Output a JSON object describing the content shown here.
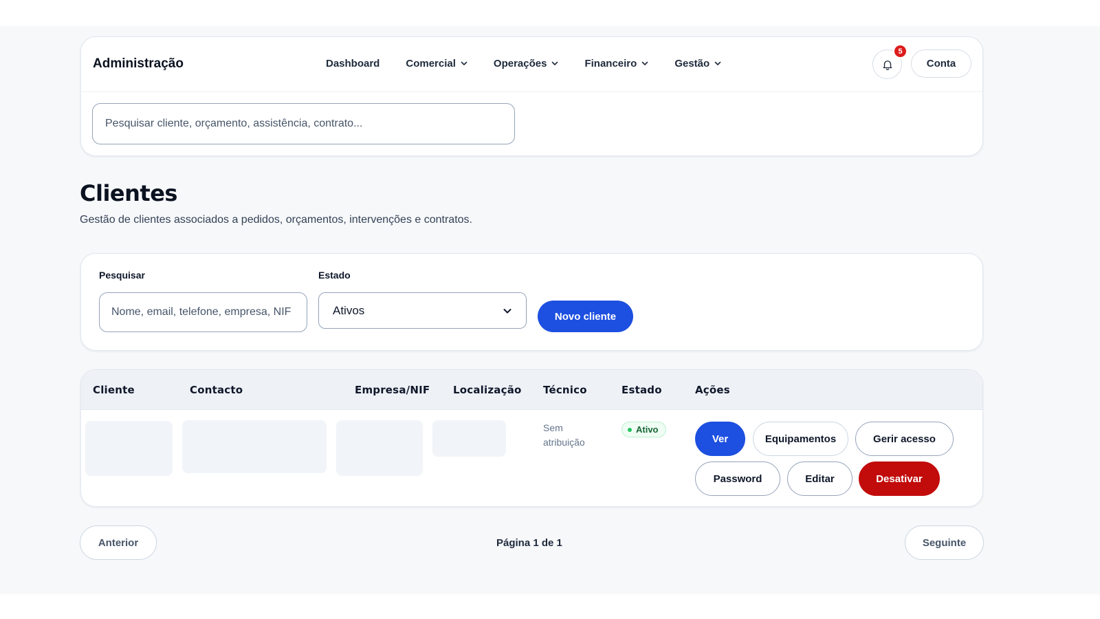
{
  "header": {
    "brand": "Administração",
    "nav": [
      {
        "label": "Dashboard",
        "dropdown": false
      },
      {
        "label": "Comercial",
        "dropdown": true
      },
      {
        "label": "Operações",
        "dropdown": true
      },
      {
        "label": "Financeiro",
        "dropdown": true
      },
      {
        "label": "Gestão",
        "dropdown": true
      }
    ],
    "notification_count": "5",
    "account_label": "Conta",
    "search_placeholder": "Pesquisar cliente, orçamento, assistência, contrato..."
  },
  "page": {
    "title": "Clientes",
    "subtitle": "Gestão de clientes associados a pedidos, orçamentos, intervenções e contratos."
  },
  "filters": {
    "search_label": "Pesquisar",
    "search_placeholder": "Nome, email, telefone, empresa, NIF",
    "status_label": "Estado",
    "status_value": "Ativos",
    "new_button": "Novo cliente"
  },
  "table": {
    "columns": [
      "Cliente",
      "Contacto",
      "Empresa/NIF",
      "Localização",
      "Técnico",
      "Estado",
      "Ações"
    ],
    "rows": [
      {
        "tecnico": "Sem atribuição",
        "estado": "Ativo",
        "actions": {
          "ver": "Ver",
          "equipamentos": "Equipamentos",
          "gerir_acesso": "Gerir acesso",
          "password": "Password",
          "editar": "Editar",
          "desativar": "Desativar"
        }
      }
    ]
  },
  "pagination": {
    "prev": "Anterior",
    "info": "Página 1 de 1",
    "next": "Seguinte"
  },
  "colors": {
    "primary": "#1d4fe0",
    "danger": "#c20b0b",
    "badge": "#dc1c1c",
    "status_active": "#22c55e"
  }
}
